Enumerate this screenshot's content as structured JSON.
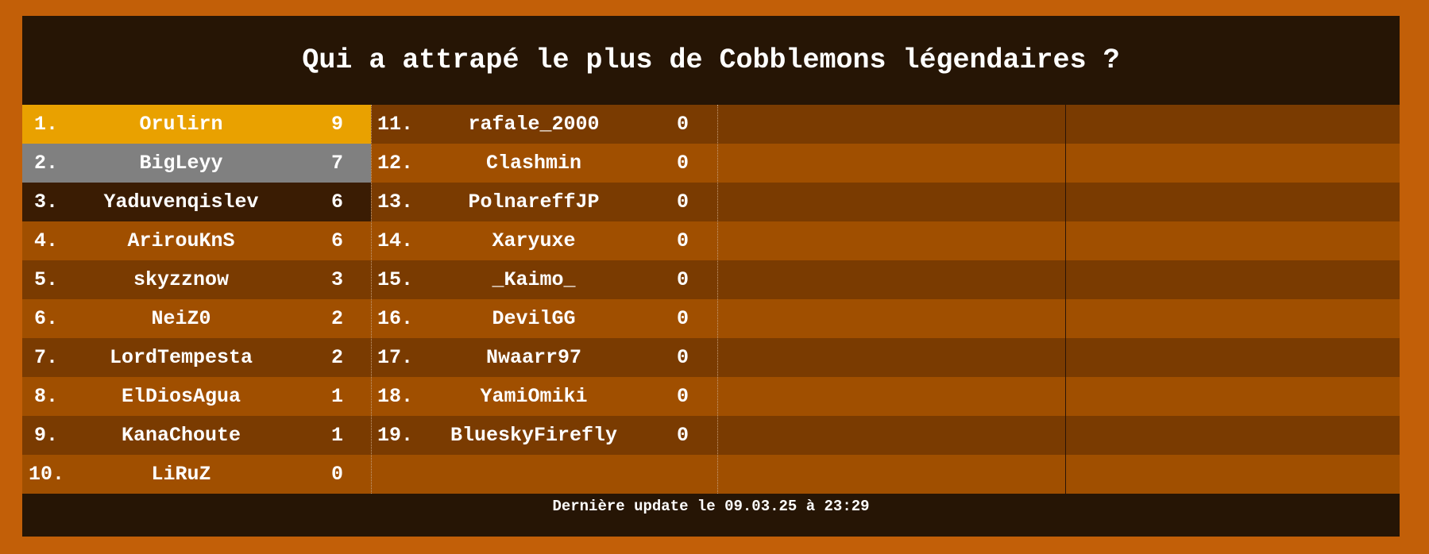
{
  "title": "Qui a attrapé le plus de Cobblemons légendaires ?",
  "footer": "Dernière update le 09.03.25 à 23:29",
  "colors": {
    "frame": "#c25f08",
    "board": "#261505",
    "row_dark": "#7a3b01",
    "row_light": "#a04f00",
    "first_place": "#e9a100",
    "second_place": "#808080",
    "third_place": "#3a1c03"
  },
  "leaderboard": {
    "column1": [
      {
        "rank": "1.",
        "name": "Orulirn",
        "score": "9"
      },
      {
        "rank": "2.",
        "name": "BigLeyy",
        "score": "7"
      },
      {
        "rank": "3.",
        "name": "Yaduvenqislev",
        "score": "6"
      },
      {
        "rank": "4.",
        "name": "ArirouKnS",
        "score": "6"
      },
      {
        "rank": "5.",
        "name": "skyzznow",
        "score": "3"
      },
      {
        "rank": "6.",
        "name": "NeiZ0",
        "score": "2"
      },
      {
        "rank": "7.",
        "name": "LordTempesta",
        "score": "2"
      },
      {
        "rank": "8.",
        "name": "ElDiosAgua",
        "score": "1"
      },
      {
        "rank": "9.",
        "name": "KanaChoute",
        "score": "1"
      },
      {
        "rank": "10.",
        "name": "LiRuZ",
        "score": "0"
      }
    ],
    "column2": [
      {
        "rank": "11.",
        "name": "rafale_2000",
        "score": "0"
      },
      {
        "rank": "12.",
        "name": "Clashmin",
        "score": "0"
      },
      {
        "rank": "13.",
        "name": "PolnareffJP",
        "score": "0"
      },
      {
        "rank": "14.",
        "name": "Xaryuxe",
        "score": "0"
      },
      {
        "rank": "15.",
        "name": "_Kaimo_",
        "score": "0"
      },
      {
        "rank": "16.",
        "name": "DevilGG",
        "score": "0"
      },
      {
        "rank": "17.",
        "name": "Nwaarr97",
        "score": "0"
      },
      {
        "rank": "18.",
        "name": "YamiOmiki",
        "score": "0"
      },
      {
        "rank": "19.",
        "name": "BlueskyFirefly",
        "score": "0"
      }
    ]
  }
}
